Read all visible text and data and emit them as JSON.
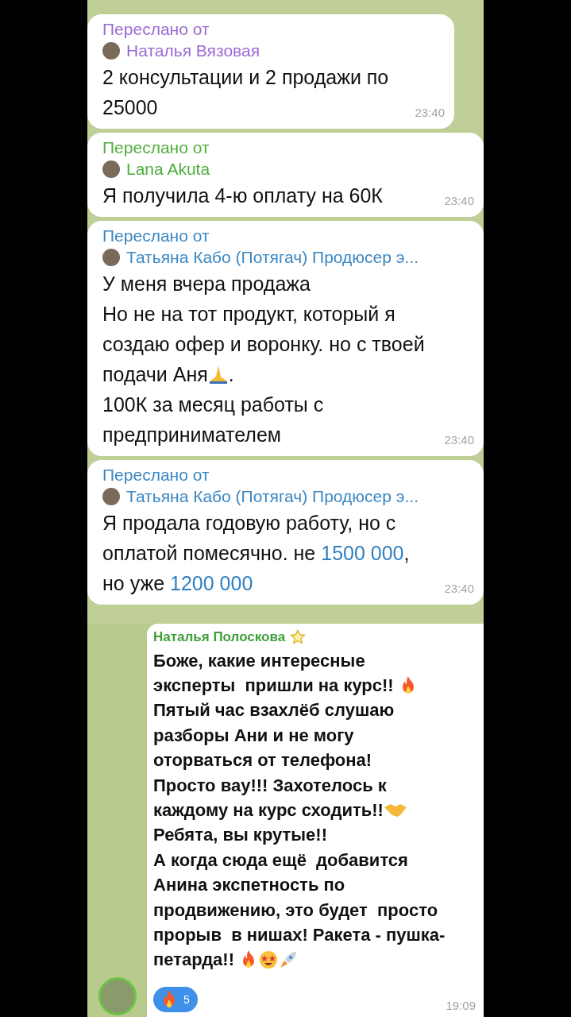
{
  "forwarded_messages": [
    {
      "forward_label": "Переслано от",
      "author": "Наталья Вязовая",
      "color": "#9a6ad4",
      "full_width": false,
      "time": "23:40",
      "lines": [
        {
          "text": "2 консультации и 2 продажи по"
        },
        {
          "text": "25000"
        }
      ]
    },
    {
      "forward_label": "Переслано от",
      "author": "Lana Akuta",
      "color": "#4fae3d",
      "full_width": true,
      "time": "23:40",
      "lines": [
        {
          "text": "Я получила 4-ю оплату на 60К"
        }
      ]
    },
    {
      "forward_label": "Переслано от",
      "author": "Татьяна Кабо (Потягач) Продюсер э...",
      "color": "#3b87c2",
      "full_width": true,
      "time": "23:40",
      "lines": [
        {
          "text": "У меня вчера продажа"
        },
        {
          "text": "Но не на тот продукт, который я"
        },
        {
          "text": "создаю офер и воронку. но с твоей"
        },
        {
          "parts": [
            {
              "kind": "plain",
              "text": "подачи Аня"
            },
            {
              "kind": "pray"
            },
            {
              "kind": "plain",
              "text": "."
            }
          ]
        },
        {
          "text": "100К за месяц работы с"
        },
        {
          "text": "предпринимателем"
        }
      ]
    },
    {
      "forward_label": "Переслано от",
      "author": "Татьяна Кабо (Потягач) Продюсер э...",
      "color": "#3b87c2",
      "full_width": true,
      "time": "23:40",
      "lines": [
        {
          "text": "Я продала годовую работу, но с"
        },
        {
          "parts": [
            {
              "kind": "plain",
              "text": "оплатой помесячно. не "
            },
            {
              "kind": "link",
              "text": "1500 000"
            },
            {
              "kind": "plain",
              "text": ","
            }
          ]
        },
        {
          "parts": [
            {
              "kind": "plain",
              "text": "но уже "
            },
            {
              "kind": "link",
              "text": "1200 000"
            }
          ]
        }
      ]
    }
  ],
  "group_message": {
    "author": "Наталья Полоскова",
    "time": "19:09",
    "reaction": {
      "count": "5"
    },
    "lines": [
      {
        "text": "Боже, какие интересные"
      },
      {
        "parts": [
          {
            "kind": "plain",
            "text": "эксперты  пришли на курс!! "
          },
          {
            "kind": "fire"
          }
        ]
      },
      {
        "text": "Пятый час взахлёб слушаю"
      },
      {
        "text": "разборы Ани и не могу"
      },
      {
        "text": "оторваться от телефона!"
      },
      {
        "text": "Просто вау!!! Захотелось к"
      },
      {
        "parts": [
          {
            "kind": "plain",
            "text": "каждому на курс сходить!!"
          },
          {
            "kind": "handshake"
          }
        ]
      },
      {
        "text": "Ребята, вы крутые!!"
      },
      {
        "text": "А когда сюда ещё  добавится"
      },
      {
        "text": "Анина экспетность по"
      },
      {
        "text": "продвижению, это будет  просто"
      },
      {
        "text": "прорыв  в нишах! Ракета - пушка-"
      },
      {
        "parts": [
          {
            "kind": "plain",
            "text": "петарда!! "
          },
          {
            "kind": "fire"
          },
          {
            "kind": "starstruck"
          },
          {
            "kind": "rocket"
          }
        ]
      }
    ]
  }
}
